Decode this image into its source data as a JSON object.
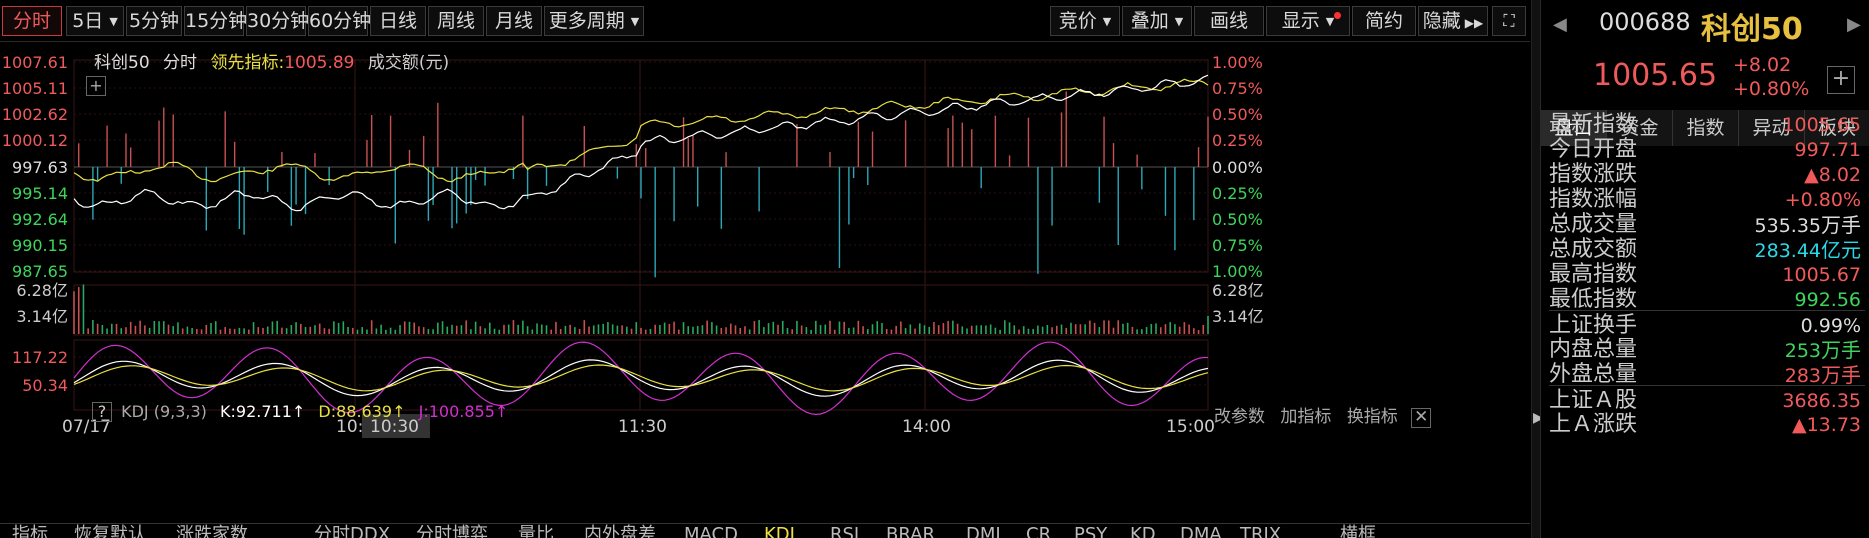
{
  "toolbar": {
    "periods": [
      "分时",
      "5日",
      "5分钟",
      "15分钟",
      "30分钟",
      "60分钟",
      "日线",
      "周线",
      "月线",
      "更多周期"
    ],
    "right_buttons": [
      "竞价",
      "叠加",
      "画线",
      "显示",
      "简约",
      "隐藏"
    ]
  },
  "legend": {
    "name": "科创50",
    "mode": "分时",
    "lead_label": "领先指标:",
    "lead_value": "1005.89",
    "vol_label": "成交额(元)"
  },
  "price_axis": {
    "left": [
      "1007.61",
      "1005.11",
      "1002.62",
      "1000.12",
      "997.63",
      "995.14",
      "992.64",
      "990.15",
      "987.65"
    ],
    "right": [
      "1.00%",
      "0.75%",
      "0.50%",
      "0.25%",
      "0.00%",
      "0.25%",
      "0.50%",
      "0.75%",
      "1.00%"
    ]
  },
  "volume_axis": {
    "left": [
      "6.28亿",
      "3.14亿"
    ],
    "right": [
      "6.28亿",
      "3.14亿"
    ]
  },
  "kdj": {
    "help": "?",
    "name": "KDJ",
    "params": "(9,3,3)",
    "k_label": "K:92.711↑",
    "d_label": "D:88.639↑",
    "j_label": "J:100.855↑",
    "axis": [
      "117.22",
      "50.34"
    ],
    "actions": [
      "改参数",
      "加指标",
      "换指标"
    ]
  },
  "time_axis": {
    "labels": [
      "07/17",
      "10:",
      "10:30",
      "11:30",
      "14:00",
      "15:00"
    ]
  },
  "bottom_tabs": [
    "指标",
    "恢复默认",
    "涨跌家数",
    "分时DDX",
    "分时博弈",
    "量比",
    "内外盘差",
    "MACD",
    "KDJ",
    "RSI",
    "BRAR",
    "DMI",
    "CR",
    "PSY",
    "KD",
    "DMA",
    "TRIX",
    "横框"
  ],
  "right_panel": {
    "code": "000688",
    "name": "科创50",
    "price": "1005.65",
    "change": "+8.02",
    "change_pct": "+0.80%",
    "tabs": [
      "盘口",
      "资金",
      "指数",
      "异动",
      "板块"
    ],
    "rows": [
      {
        "label": "最新指数",
        "value": "1005.65",
        "color": "red"
      },
      {
        "label": "今日开盘",
        "value": "997.71",
        "color": "red"
      },
      {
        "label": "指数涨跌",
        "value": "▲8.02",
        "color": "red"
      },
      {
        "label": "指数涨幅",
        "value": "+0.80%",
        "color": "red"
      },
      {
        "label": "总成交量",
        "value": "535.35",
        "unit": "万手",
        "color": "white"
      },
      {
        "label": "总成交额",
        "value": "283.44",
        "unit": "亿元",
        "color": "cyan"
      },
      {
        "label": "最高指数",
        "value": "1005.67",
        "color": "red"
      },
      {
        "label": "最低指数",
        "value": "992.56",
        "color": "green"
      },
      {
        "label": "上证换手",
        "value": "0.99%",
        "color": "white"
      },
      {
        "label": "内盘总量",
        "value": "253",
        "unit": "万手",
        "color": "green"
      },
      {
        "label": "外盘总量",
        "value": "283",
        "unit": "万手",
        "color": "red"
      },
      {
        "label": "上证Ａ股",
        "value": "3686.35",
        "color": "red"
      },
      {
        "label": "上Ａ涨跌",
        "value": "▲13.73",
        "color": "red"
      }
    ]
  },
  "colors": {
    "up": "#f05a5a",
    "down": "#2ab8c8",
    "price_line": "#ffffff",
    "lead_line": "#e8e040",
    "k": "#ffffff",
    "d": "#e8e040",
    "j": "#d030d0"
  }
}
